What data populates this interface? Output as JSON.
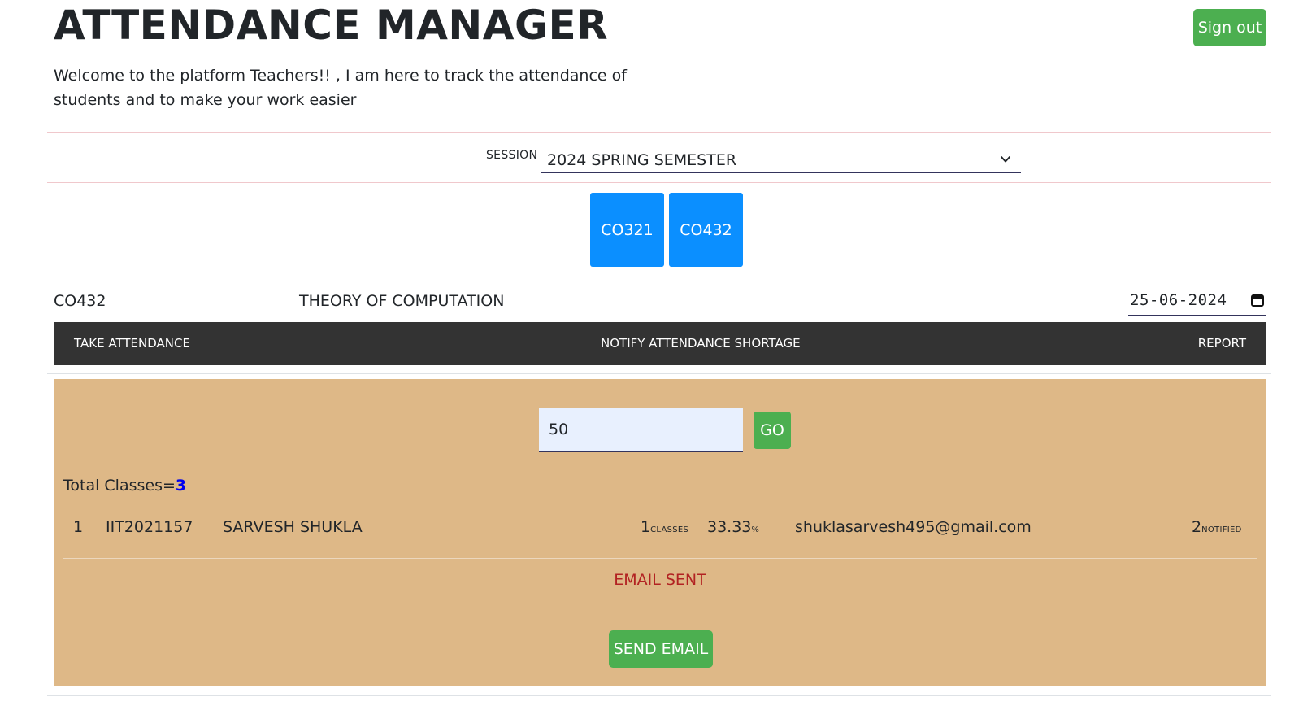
{
  "header": {
    "title": "ATTENDANCE MANAGER",
    "welcome": "Welcome to the platform Teachers!! , I am here to track the attendance of students and to make your work easier",
    "signout_label": "Sign out"
  },
  "session": {
    "label": "SESSION",
    "selected": "2024 SPRING SEMESTER",
    "icon": "chevron-down-icon"
  },
  "courses": [
    "CO321",
    "CO432"
  ],
  "selected_course": {
    "code": "CO432",
    "name": "THEORY OF COMPUTATION",
    "date": "25-06-2024",
    "date_icon": "calendar-icon"
  },
  "nav": {
    "take_attendance": "TAKE ATTENDANCE",
    "notify_shortage": "NOTIFY ATTENDANCE SHORTAGE",
    "report": "REPORT"
  },
  "shortage": {
    "threshold_value": "50",
    "go_label": "GO",
    "total_label": "Total Classes=",
    "total_value": "3",
    "students": [
      {
        "sno": "1",
        "roll": "IIT2021157",
        "name": "SARVESH SHUKLA",
        "classes": "1",
        "classes_unit": "CLASSES",
        "percent": "33.33",
        "percent_unit": "%",
        "email": "shuklasarvesh495@gmail.com",
        "notified": "2",
        "notified_unit": "NOTIFIED"
      }
    ],
    "status": "EMAIL SENT",
    "send_label": "SEND EMAIL"
  },
  "colors": {
    "accent_green": "#4caf50",
    "course_blue": "#0b8fff",
    "panel_tan": "#deb887",
    "navbar_dark": "#333333",
    "status_red": "#b22222"
  }
}
